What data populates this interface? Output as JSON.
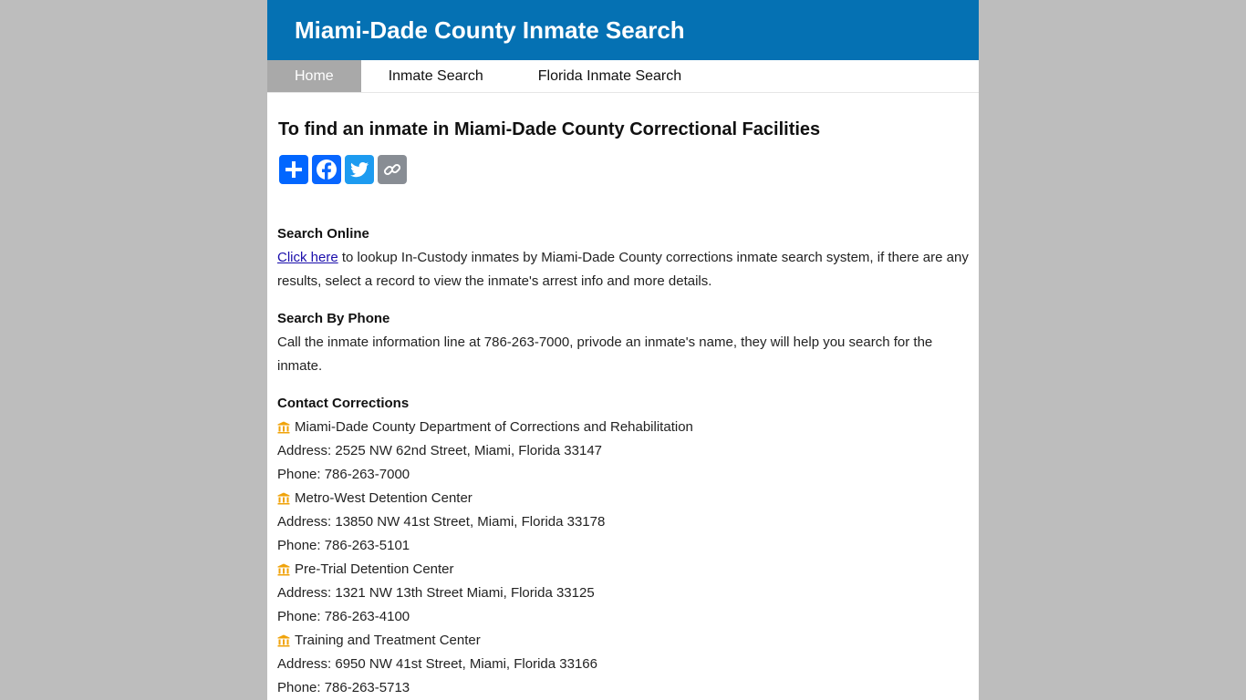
{
  "header": {
    "title": "Miami-Dade County Inmate Search"
  },
  "nav": {
    "items": [
      {
        "label": "Home",
        "active": true
      },
      {
        "label": "Inmate Search",
        "active": false
      },
      {
        "label": "Florida Inmate Search",
        "active": false
      }
    ]
  },
  "main": {
    "heading": "To find an inmate in Miami-Dade County Correctional Facilities",
    "share_icons": [
      "plus-icon",
      "facebook-icon",
      "twitter-icon",
      "copy-link-icon"
    ],
    "search_online": {
      "title": "Search Online",
      "link_text": "Click here",
      "text": " to lookup In-Custody inmates by Miami-Dade County corrections inmate search system, if there are any results, select a record to view the inmate's arrest info and more details."
    },
    "search_phone": {
      "title": "Search By Phone",
      "text": "Call the inmate information line at 786-263-7000, privode an inmate's name, they will help you search for the inmate."
    },
    "contact": {
      "title": "Contact Corrections",
      "facilities": [
        {
          "name": "Miami-Dade County Department of Corrections and Rehabilitation",
          "address": "Address: 2525 NW 62nd Street, Miami, Florida 33147",
          "phone": "Phone: 786-263-7000"
        },
        {
          "name": "Metro-West Detention Center",
          "address": "Address: 13850 NW 41st Street, Miami, Florida 33178",
          "phone": "Phone: 786-263-5101"
        },
        {
          "name": "Pre-Trial Detention Center",
          "address": "Address: 1321 NW 13th Street Miami, Florida 33125",
          "phone": "Phone: 786-263-4100"
        },
        {
          "name": "Training and Treatment Center",
          "address": "Address: 6950 NW 41st Street, Miami, Florida 33166",
          "phone": "Phone: 786-263-5713"
        }
      ]
    }
  },
  "colors": {
    "banner": "#0571b3",
    "nav_active": "#a9a9a9",
    "icon_building": "#f0a30a"
  }
}
